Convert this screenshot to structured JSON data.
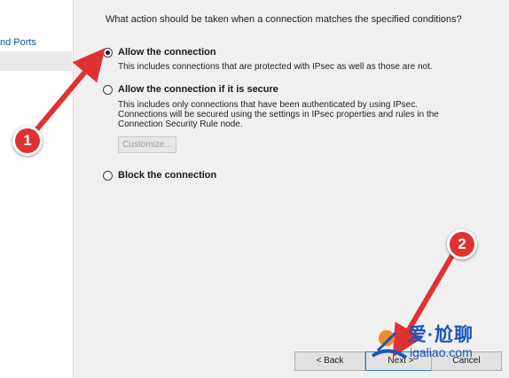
{
  "sidebar": {
    "items": [
      {
        "label": "nd Ports"
      },
      {
        "label": ""
      }
    ]
  },
  "main": {
    "question": "What action should be taken when a connection matches the specified conditions?",
    "options": [
      {
        "label": "Allow the connection",
        "selected": true,
        "description": "This includes connections that are protected with IPsec as well as those are not."
      },
      {
        "label": "Allow the connection if it is secure",
        "selected": false,
        "description": "This includes only connections that have been authenticated by using IPsec.  Connections will be secured using the settings in IPsec properties and rules in the Connection Security Rule node."
      },
      {
        "label": "Block the connection",
        "selected": false
      }
    ],
    "customize_label": "Customize..."
  },
  "footer": {
    "back_label": "< Back",
    "next_label": "Next >",
    "cancel_label": "Cancel"
  },
  "annotations": {
    "callout_1": "1",
    "callout_2": "2",
    "arrow_color": "#e03232"
  },
  "watermark": {
    "title": "爱·尬聊",
    "url": "igaliao.com"
  }
}
